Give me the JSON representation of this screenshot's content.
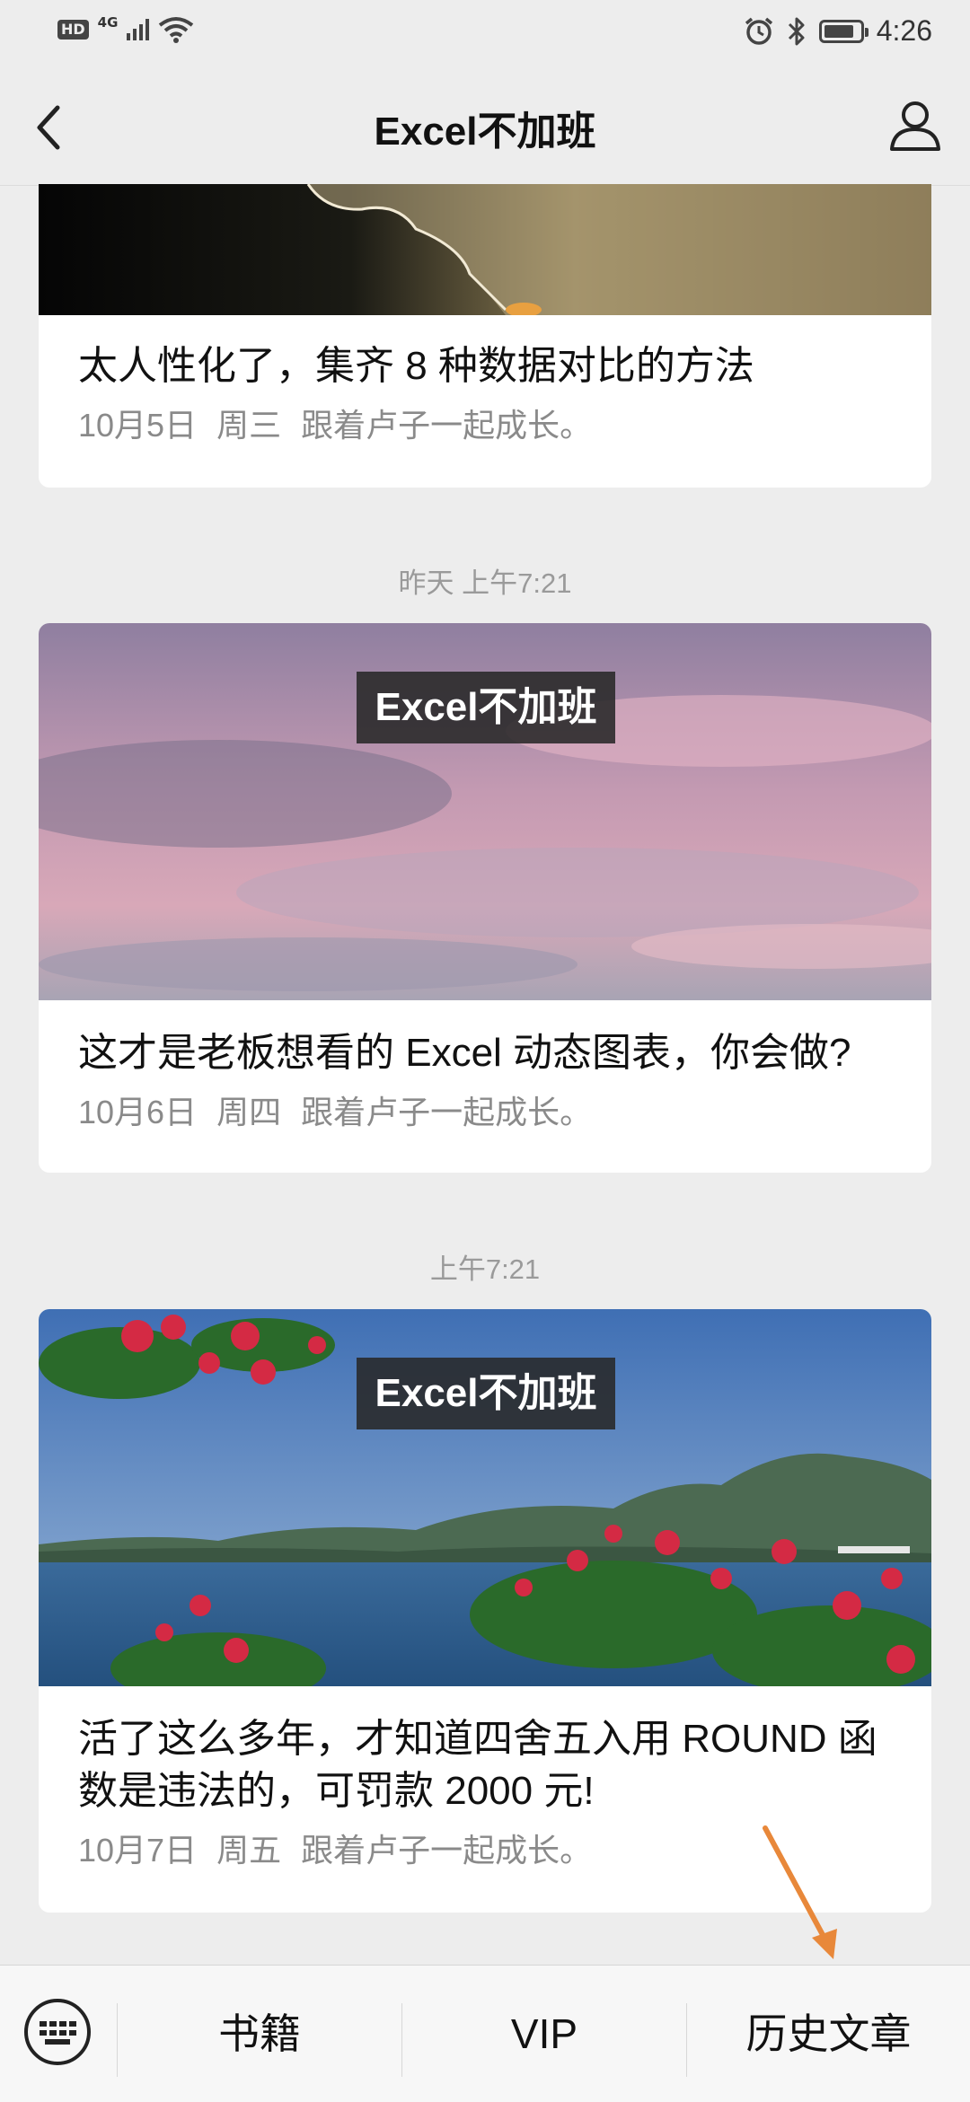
{
  "status_bar": {
    "hd": "HD",
    "network": "4G",
    "time": "4:26"
  },
  "nav": {
    "title": "Excel不加班",
    "back_icon": "chevron-left-icon",
    "profile_icon": "user-icon"
  },
  "articles": [
    {
      "title": "太人性化了，集齐 8 种数据对比的方法",
      "date": "10月5日",
      "weekday": "周三",
      "author": "跟着卢子一起成长。"
    },
    {
      "timestamp": "昨天 上午7:21",
      "badge": "Excel不加班",
      "title": "这才是老板想看的 Excel 动态图表，你会做?",
      "date": "10月6日",
      "weekday": "周四",
      "author": "跟着卢子一起成长。"
    },
    {
      "timestamp": "上午7:21",
      "badge": "Excel不加班",
      "title": "活了这么多年，才知道四舍五入用 ROUND 函数是违法的，可罚款 2000 元!",
      "date": "10月7日",
      "weekday": "周五",
      "author": "跟着卢子一起成长。"
    }
  ],
  "bottom_menu": {
    "keyboard_icon": "keyboard-icon",
    "items": [
      "书籍",
      "VIP",
      "历史文章"
    ]
  },
  "colors": {
    "background": "#ededed",
    "card": "#ffffff",
    "meta_text": "#8a8a8a",
    "annotation_arrow": "#e8883a"
  }
}
